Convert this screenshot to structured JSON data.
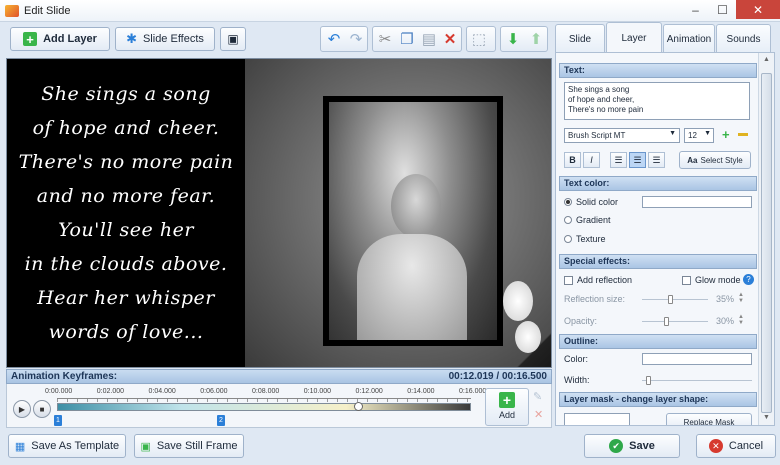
{
  "window": {
    "title": "Edit Slide",
    "controls": [
      "–",
      "☐",
      "✕"
    ]
  },
  "toolbar": {
    "add_layer_label": "Add Layer",
    "slide_effects_label": "Slide Effects"
  },
  "poem": {
    "lines": [
      "She sings a song",
      "of hope and cheer.",
      "There's no more pain",
      "and no more fear.",
      "You'll see her",
      "in the clouds above.",
      "Hear her whisper",
      "words of love..."
    ]
  },
  "keyframes": {
    "title": "Animation Keyframes:",
    "time_readout": "00:12.019 / 00:16.500",
    "ticks": [
      "0:00.000",
      "0:02.000",
      "0:04.000",
      "0:06.000",
      "0:08.000",
      "0:10.000",
      "0:12.000",
      "0:14.000",
      "0:16.000"
    ],
    "markers": [
      "1",
      "2"
    ],
    "add_label": "Add",
    "playhead_fraction": 0.728
  },
  "bottom": {
    "save_template_label": "Save As Template",
    "save_frame_label": "Save Still Frame",
    "save_label": "Save",
    "cancel_label": "Cancel"
  },
  "tabs": [
    "Slide",
    "Layer",
    "Animation",
    "Sounds"
  ],
  "active_tab": "Layer",
  "layer": {
    "text_header": "Text:",
    "text_value": [
      "She sings a song",
      "of hope and cheer,",
      "There's no more pain"
    ],
    "font": "Brush Script MT",
    "size": "12",
    "select_style_label": "Select Style",
    "text_color_header": "Text color:",
    "solid_label": "Solid color",
    "gradient_label": "Gradient",
    "texture_label": "Texture",
    "special_header": "Special effects:",
    "reflection_label": "Add reflection",
    "glow_label": "Glow mode",
    "reflection_size_label": "Reflection size:",
    "reflection_size": "35%",
    "opacity_label": "Opacity:",
    "opacity": "30%",
    "outline_header": "Outline:",
    "color_label": "Color:",
    "width_label": "Width:",
    "mask_header": "Layer mask - change layer shape:",
    "replace_mask_label": "Replace Mask"
  },
  "colors": {
    "accent": "#3b82d6",
    "save_green": "#2fa84a",
    "cancel_red": "#d63a2f"
  }
}
